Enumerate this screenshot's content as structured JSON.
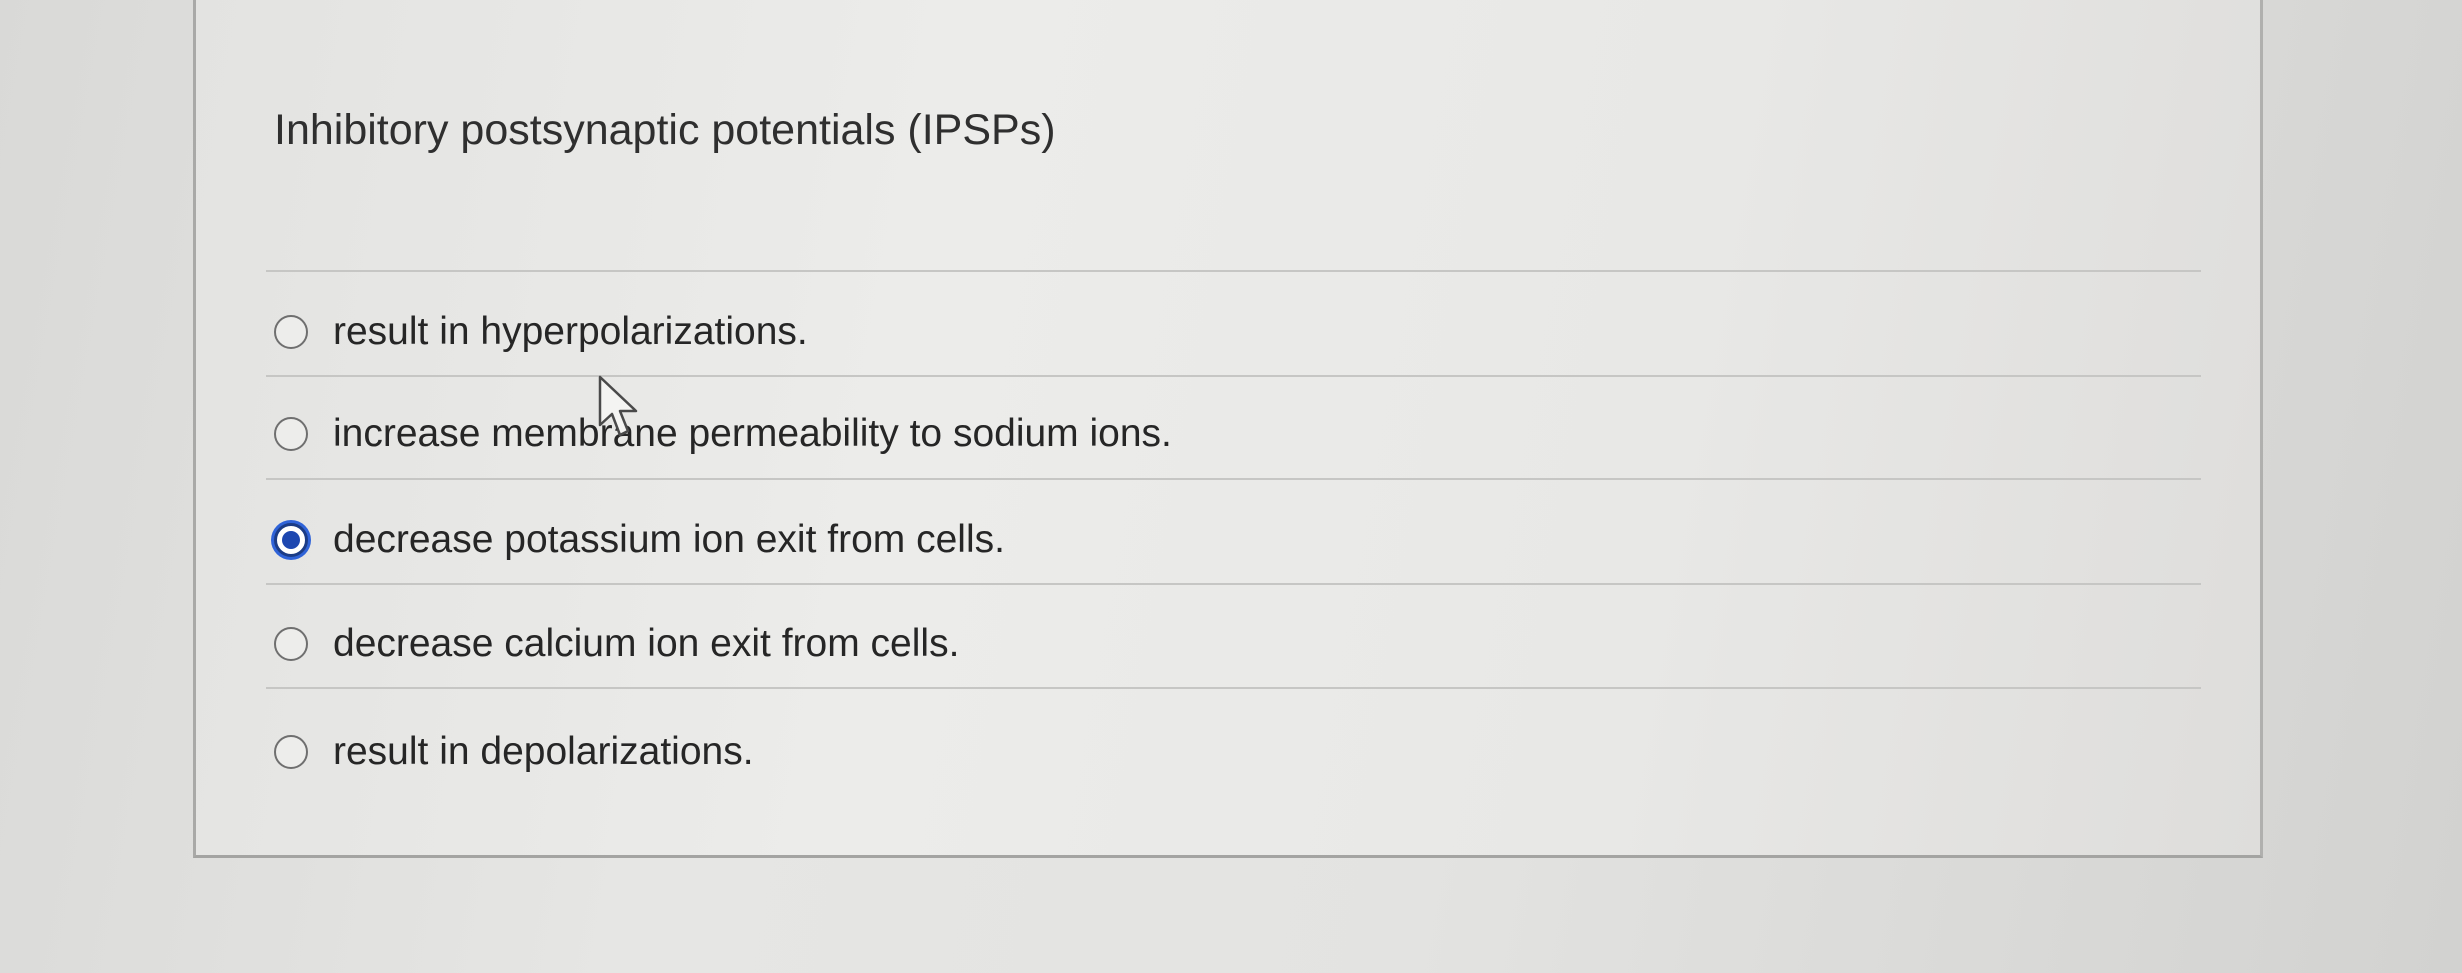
{
  "question": {
    "text": "Inhibitory postsynaptic potentials (IPSPs)"
  },
  "options": [
    {
      "label": "result in hyperpolarizations.",
      "selected": false
    },
    {
      "label": "increase membrane permeability to sodium ions.",
      "selected": false
    },
    {
      "label": "decrease potassium ion exit from cells.",
      "selected": true
    },
    {
      "label": "decrease calcium ion exit from cells.",
      "selected": false
    },
    {
      "label": "result in depolarizations.",
      "selected": false
    }
  ],
  "colors": {
    "radio_selected": "#1d47b0",
    "radio_focus_ring": "#2f63d8",
    "text": "#262626"
  },
  "icons": {
    "cursor": "mouse-pointer-icon"
  }
}
